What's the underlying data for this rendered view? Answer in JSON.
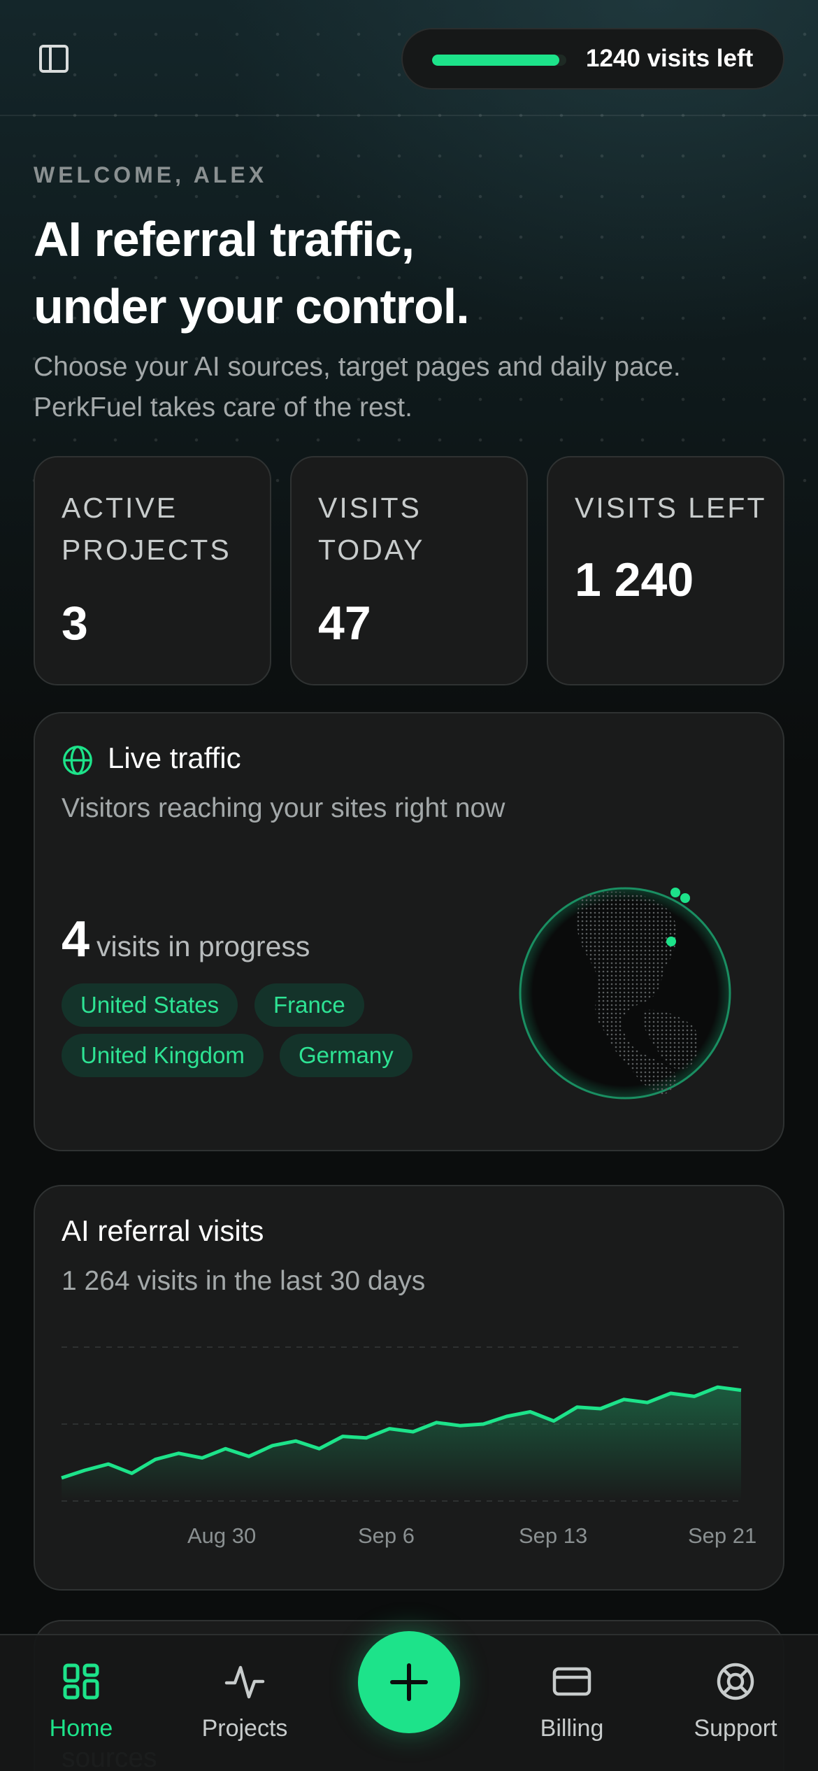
{
  "topbar": {
    "sidebar_icon": "sidebar-toggle-icon",
    "visits_left_label": "1240 visits left",
    "visits_left_fraction": 0.95
  },
  "hero": {
    "welcome": "WELCOME, ALEX",
    "headline_line1": "AI referral traffic,",
    "headline_line2": "under your control.",
    "subhead": "Choose your AI sources, target pages and daily pace. PerkFuel takes care of the rest."
  },
  "stats": [
    {
      "label": "ACTIVE PROJECTS",
      "value": "3"
    },
    {
      "label": "VISITS TODAY",
      "value": "47"
    },
    {
      "label": "VISITS LEFT",
      "value": "1 240"
    }
  ],
  "live_traffic": {
    "icon": "globe-icon",
    "title": "Live traffic",
    "subtitle": "Visitors reaching your sites right now",
    "count": "4",
    "count_label": "visits in progress",
    "countries": [
      "United States",
      "France",
      "United Kingdom",
      "Germany"
    ]
  },
  "referral_chart": {
    "title": "AI referral visits",
    "subtitle": "1 264 visits in the last 30 days"
  },
  "chart_data": {
    "type": "area",
    "title": "AI referral visits",
    "subtitle": "1 264 visits in the last 30 days",
    "x_tick_labels": [
      "Aug 30",
      "Sep 6",
      "Sep 13",
      "Sep 21"
    ],
    "values": [
      15,
      20,
      24,
      18,
      27,
      31,
      28,
      34,
      29,
      36,
      39,
      34,
      42,
      41,
      47,
      45,
      51,
      49,
      50,
      55,
      58,
      52,
      61,
      60,
      66,
      64,
      70,
      68,
      74,
      72
    ],
    "ylim": [
      0,
      100
    ],
    "grid": true,
    "legend": "none",
    "color": "#1de38a"
  },
  "nav": {
    "items": [
      {
        "label": "Home",
        "icon": "home-grid-icon"
      },
      {
        "label": "Projects",
        "icon": "activity-icon"
      },
      {
        "label": "Billing",
        "icon": "card-icon"
      },
      {
        "label": "Support",
        "icon": "lifebuoy-icon"
      }
    ],
    "fab_icon": "plus-icon",
    "active_color": "#1de38a"
  },
  "peek_card_text": "sources"
}
